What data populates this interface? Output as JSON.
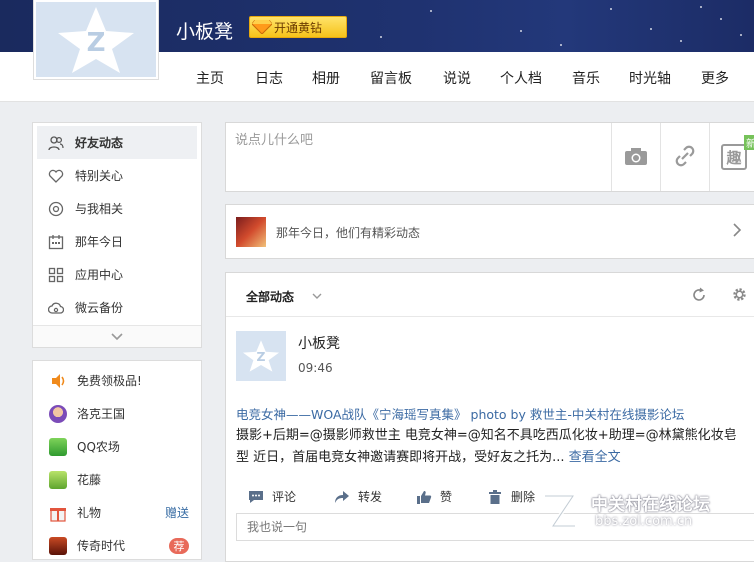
{
  "profile": {
    "name": "小板凳",
    "vip_label": "开通黄钻"
  },
  "nav": {
    "items": [
      "主页",
      "日志",
      "相册",
      "留言板",
      "说说",
      "个人档",
      "音乐",
      "时光轴",
      "更多"
    ]
  },
  "sidebar": {
    "items": [
      {
        "label": "好友动态",
        "icon": "friends-icon",
        "active": true
      },
      {
        "label": "特别关心",
        "icon": "heart-icon"
      },
      {
        "label": "与我相关",
        "icon": "at-icon"
      },
      {
        "label": "那年今日",
        "icon": "calendar-icon"
      },
      {
        "label": "应用中心",
        "icon": "grid-icon"
      },
      {
        "label": "微云备份",
        "icon": "cloud-icon"
      }
    ]
  },
  "apps": {
    "items": [
      {
        "label": "免费领极品!",
        "icon": "gift-sound-icon",
        "color": "#f08a1c"
      },
      {
        "label": "洛克王国",
        "icon": "rocko-icon",
        "color": "#7b4bb8"
      },
      {
        "label": "QQ农场",
        "icon": "farm-icon",
        "color": "#3faa3a"
      },
      {
        "label": "花藤",
        "icon": "flower-icon",
        "color": "#6abf3a"
      },
      {
        "label": "礼物",
        "icon": "gift-icon",
        "color": "#e2553d",
        "extra": "赠送"
      },
      {
        "label": "传奇时代",
        "icon": "legend-icon",
        "color": "#8a2b1a",
        "badge": "荐"
      }
    ]
  },
  "post": {
    "placeholder": "说点儿什么吧",
    "new_tag": "新",
    "fun_label": "趣"
  },
  "today": {
    "text": "那年今日，他们有精彩动态"
  },
  "feed": {
    "tab": "全部动态",
    "item": {
      "name": "小板凳",
      "time": "09:46",
      "title": "电竞女神——WOA战队《宁海瑶写真集》 photo by 救世主-中关村在线摄影论坛",
      "body": "摄影+后期=@摄影师救世主 电竞女神=@知名不具吃西瓜化妆+助理=@林黛熊化妆皂型 近日，首届电竞女神邀请赛即将开战，受好友之托为...",
      "more": "查看全文"
    },
    "actions": [
      "评论",
      "转发",
      "赞",
      "删除"
    ],
    "comment_placeholder": "我也说一句"
  },
  "watermark": {
    "text": "中关村在线论坛",
    "url": "bbs.zol.com.cn"
  }
}
